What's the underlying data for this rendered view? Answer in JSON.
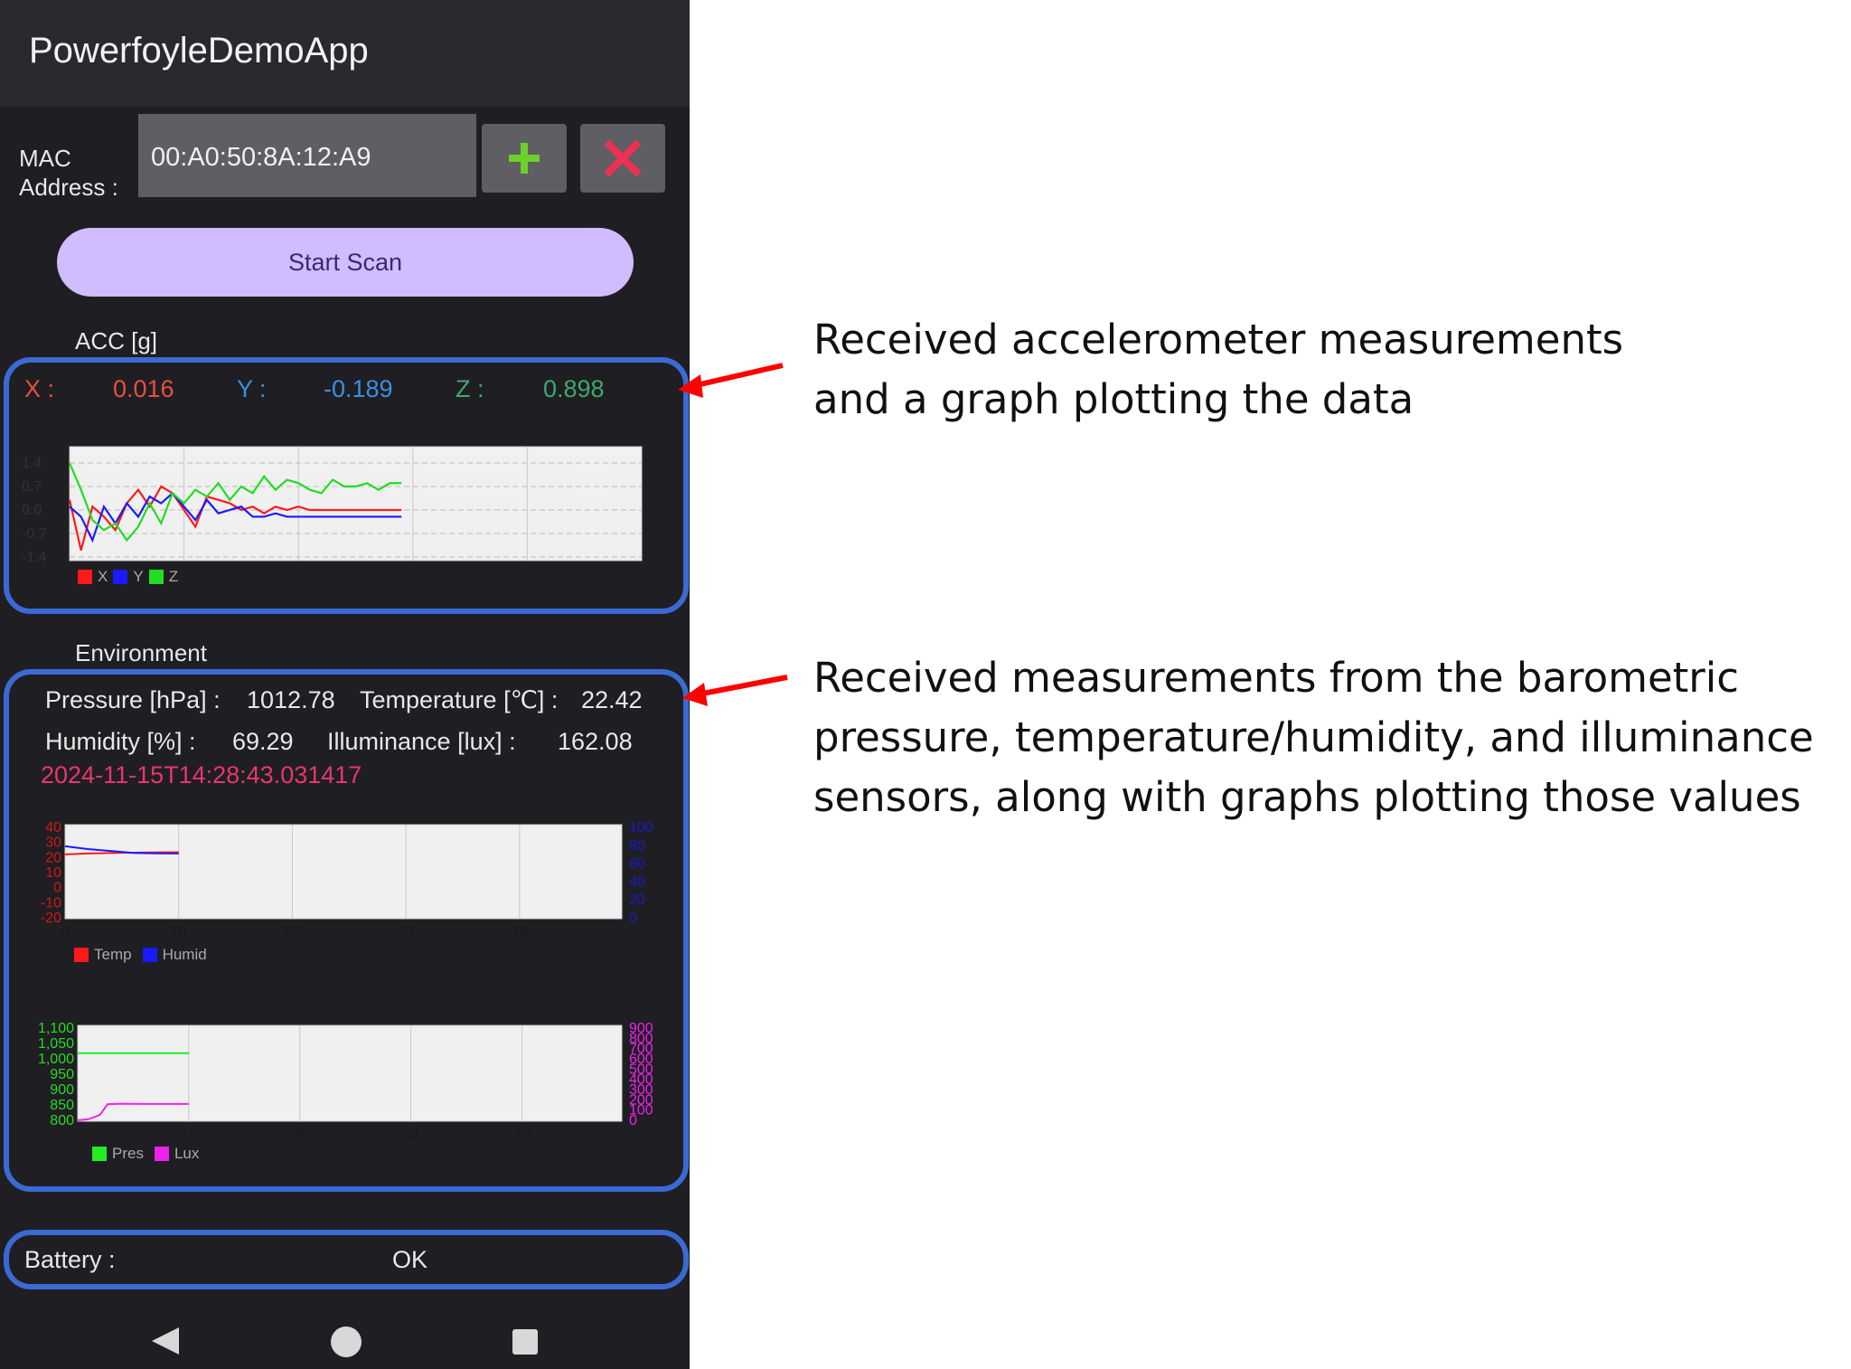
{
  "app": {
    "title": "PowerfoyleDemoApp"
  },
  "mac": {
    "label_line1": "MAC",
    "label_line2": "Address :",
    "value": "00:A0:50:8A:12:A9",
    "add_icon": "plus-icon",
    "remove_icon": "close-icon"
  },
  "scan": {
    "label": "Start Scan"
  },
  "acc": {
    "section_title": "ACC [g]",
    "x_label": "X :",
    "x_value": "0.016",
    "y_label": "Y :",
    "y_value": "-0.189",
    "z_label": "Z :",
    "z_value": "0.898",
    "colors": {
      "x": "#e8503c",
      "y": "#3c8fe0",
      "z": "#3da870"
    }
  },
  "environment": {
    "section_title": "Environment",
    "pressure_label": "Pressure [hPa] :",
    "pressure_value": "1012.78",
    "temperature_label": "Temperature [℃] :",
    "temperature_value": "22.42",
    "humidity_label": "Humidity [%] :",
    "humidity_value": "69.29",
    "illuminance_label": "Illuminance [lux] :",
    "illuminance_value": "162.08",
    "timestamp": "2024-11-15T14:28:43.031417"
  },
  "battery": {
    "label": "Battery :",
    "value": "OK"
  },
  "nav": {
    "back_icon": "back-triangle-icon",
    "home_icon": "home-circle-icon",
    "recents_icon": "recents-square-icon"
  },
  "annotations": {
    "acc_line1": "Received accelerometer measurements",
    "acc_line2": "and a graph plotting the data",
    "env_line1": "Received measurements from the barometric",
    "env_line2": "pressure, temperature/humidity, and illuminance",
    "env_line3": "sensors, along with graphs plotting those values"
  },
  "chart_data": [
    {
      "type": "line",
      "y_ticks": [
        "1.4",
        "0.7",
        "0.0",
        "-0.7",
        "-1.4"
      ],
      "ylim": [
        -1.4,
        1.4
      ],
      "xlim": [
        0,
        50
      ],
      "grid": true,
      "legend_position": "bottom-left",
      "series": [
        {
          "name": "X",
          "color": "#ff1a1a",
          "values": [
            0.3,
            -1.2,
            0.1,
            -0.2,
            -0.6,
            0.2,
            0.6,
            0.1,
            0.7,
            0.5,
            0.0,
            -0.5,
            0.4,
            0.3,
            0.2,
            0.0,
            0.1,
            -0.1,
            0.1,
            0.0,
            0.1,
            0.0,
            0.0,
            0.0,
            0.0,
            0.0,
            0.0,
            0.0,
            0.0,
            0.0
          ]
        },
        {
          "name": "Y",
          "color": "#1a1aff",
          "values": [
            0.1,
            -0.2,
            -0.9,
            0.1,
            -0.4,
            0.2,
            -0.2,
            0.4,
            0.2,
            0.5,
            0.1,
            -0.3,
            0.3,
            -0.1,
            0.0,
            0.1,
            -0.2,
            -0.2,
            -0.1,
            -0.2,
            -0.2,
            -0.2,
            -0.2,
            -0.2,
            -0.2,
            -0.2,
            -0.2,
            -0.2,
            -0.2,
            -0.2
          ]
        },
        {
          "name": "Z",
          "color": "#22dd22",
          "values": [
            1.4,
            0.6,
            -0.3,
            -0.6,
            -0.4,
            -0.9,
            -0.5,
            0.2,
            -0.4,
            0.5,
            0.2,
            0.6,
            0.4,
            0.8,
            0.3,
            0.7,
            0.5,
            1.0,
            0.6,
            0.9,
            0.8,
            0.6,
            0.5,
            0.9,
            0.7,
            0.7,
            0.8,
            0.6,
            0.8,
            0.8
          ]
        }
      ]
    },
    {
      "type": "line",
      "x_ticks": [
        "0",
        "10",
        "20",
        "30",
        "40"
      ],
      "xlim": [
        0,
        49
      ],
      "y_left_ticks": [
        "40",
        "30",
        "20",
        "10",
        "0",
        "-10",
        "-20"
      ],
      "y_left_lim": [
        -20,
        40
      ],
      "y_right_ticks": [
        "100",
        "80",
        "60",
        "40",
        "20",
        "0"
      ],
      "y_right_lim": [
        0,
        100
      ],
      "legend_position": "bottom-left",
      "series": [
        {
          "name": "Temp",
          "color": "#ff1a1a",
          "axis": "left",
          "x": [
            0,
            2,
            4,
            6,
            8,
            10
          ],
          "values": [
            21,
            21.6,
            21.9,
            22.1,
            22.3,
            22.4
          ]
        },
        {
          "name": "Humid",
          "color": "#1a1aff",
          "axis": "right",
          "x": [
            0,
            2,
            4,
            6,
            8,
            10
          ],
          "values": [
            77,
            74,
            72,
            70,
            69.5,
            69.3
          ]
        }
      ]
    },
    {
      "type": "line",
      "x_ticks": [
        "0",
        "10",
        "20",
        "30",
        "40"
      ],
      "xlim": [
        0,
        49
      ],
      "y_left_ticks": [
        "1,100",
        "1,050",
        "1,000",
        "950",
        "900",
        "850",
        "800"
      ],
      "y_left_lim": [
        800,
        1100
      ],
      "y_right_ticks": [
        "900",
        "800",
        "700",
        "600",
        "500",
        "400",
        "300",
        "200",
        "100",
        "0"
      ],
      "y_right_lim": [
        0,
        900
      ],
      "legend_position": "bottom-left",
      "series": [
        {
          "name": "Pres",
          "color": "#22ee22",
          "axis": "left",
          "x": [
            0,
            2,
            4,
            6,
            8,
            10
          ],
          "values": [
            1012.8,
            1012.8,
            1012.8,
            1012.8,
            1012.8,
            1012.8
          ]
        },
        {
          "name": "Lux",
          "color": "#ee22ee",
          "axis": "right",
          "x": [
            0,
            1,
            2,
            2.7,
            4,
            6,
            8,
            10
          ],
          "values": [
            10,
            20,
            60,
            160,
            164,
            162,
            162,
            162
          ]
        }
      ]
    }
  ]
}
